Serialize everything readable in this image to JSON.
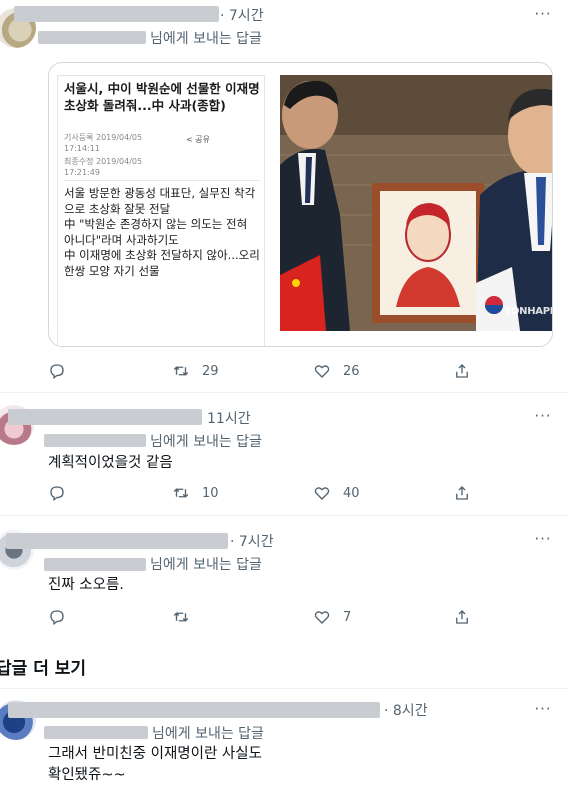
{
  "tweets": [
    {
      "time": "· 7시간",
      "reply_to": "님에게 보내는 답글",
      "body": "",
      "card": {
        "headline": "서울시, 中이 박원순에 선물한 이재명 초상화 돌려줘...中 사과(종합)",
        "posted": "기사등록 2019/04/05 17:14:11",
        "updated": "최종수정 2019/04/05 17:21:49",
        "share_label": "< 공유",
        "summary": [
          "서울 방문한 광동성 대표단, 실무진 착각으로 초상화 잘못 전달",
          "中 \"박원순 존경하지 않는 의도는 전혀 아니다\"라며 사과하기도",
          "中 이재명에 초상화 전달하지 않아...오리 한쌍 모양 자기 선물"
        ],
        "watermark": "YONHAPNEWS"
      },
      "replies": "29",
      "retweets_icon": "retweet-icon",
      "likes": "26"
    },
    {
      "time": "11시간",
      "reply_to": "님에게 보내는 답글",
      "body": "계획적이었을것 같음",
      "replies": "10",
      "likes": "40"
    },
    {
      "time": "· 7시간",
      "reply_to": "님에게 보내는 답글",
      "body": "진짜 소오름.",
      "replies": "",
      "likes": "7"
    },
    {
      "time": "· 8시간",
      "reply_to": "님에게 보내는 답글",
      "body": "그래서 반미친중 이재명이란 사실도\n확인됐쥬~~"
    }
  ],
  "section_header": "답글 더 보기",
  "more_label": "···",
  "colors": {
    "secondary_text": "#536471",
    "divider": "#eff3f4",
    "redacted": "#c9ccd0"
  }
}
